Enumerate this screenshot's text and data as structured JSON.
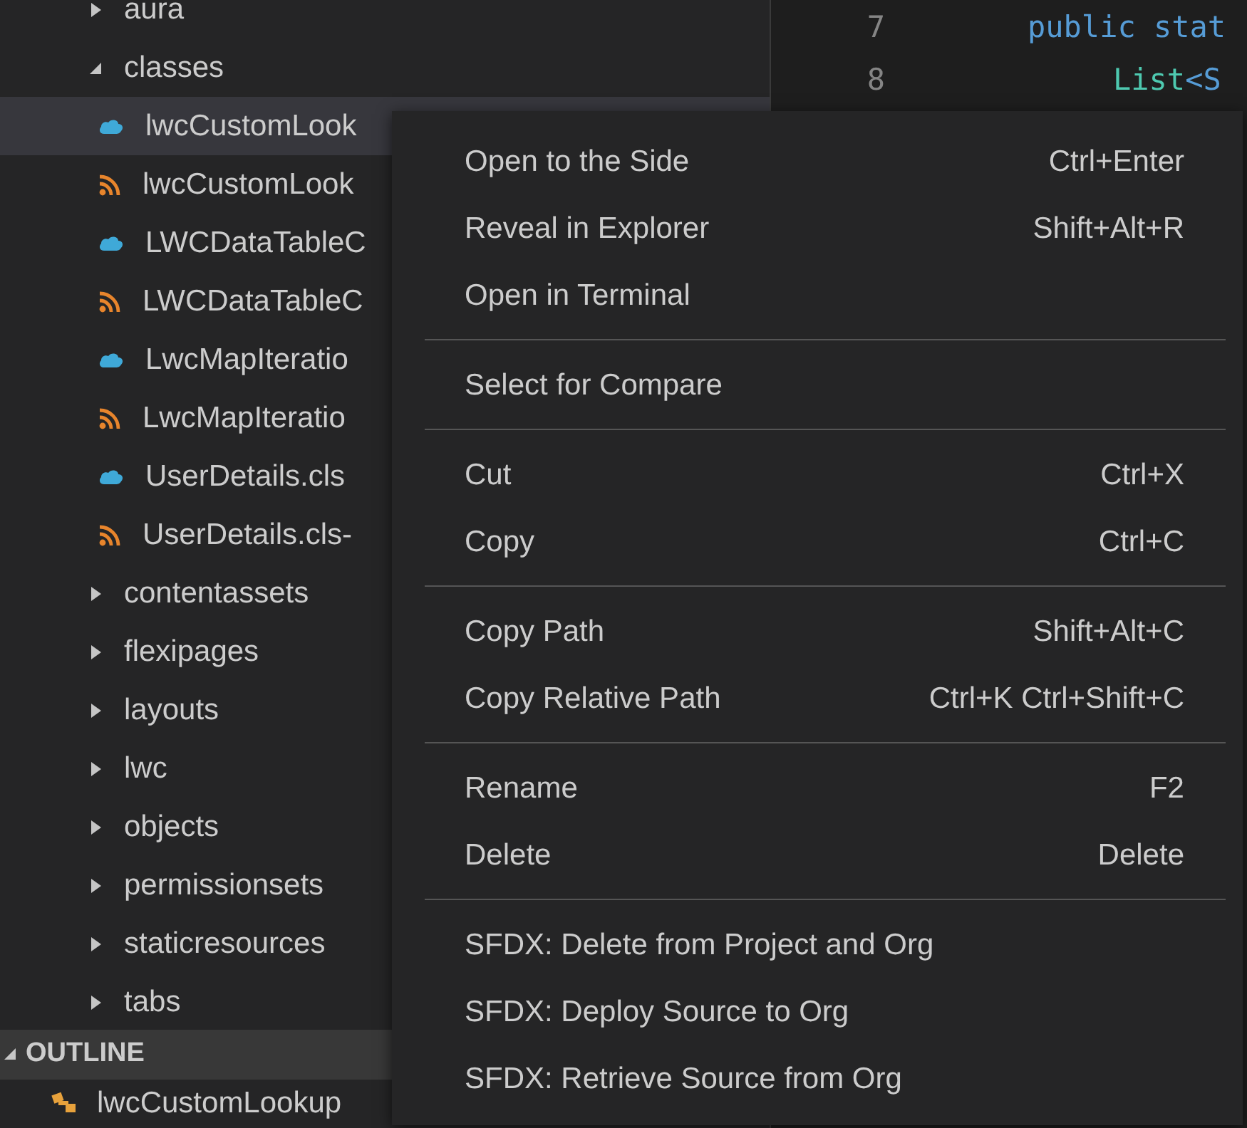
{
  "explorer": {
    "tree": [
      {
        "label": "aura",
        "expanded": false,
        "selected": false
      },
      {
        "label": "classes",
        "expanded": true,
        "selected": false,
        "children": [
          {
            "label": "lwcCustomLook",
            "kind": "apex",
            "selected": true
          },
          {
            "label": "lwcCustomLook",
            "kind": "meta",
            "selected": false
          },
          {
            "label": "LWCDataTableC",
            "kind": "apex",
            "selected": false
          },
          {
            "label": "LWCDataTableC",
            "kind": "meta",
            "selected": false
          },
          {
            "label": "LwcMapIteratio",
            "kind": "apex",
            "selected": false
          },
          {
            "label": "LwcMapIteratio",
            "kind": "meta",
            "selected": false
          },
          {
            "label": "UserDetails.cls",
            "kind": "apex",
            "selected": false
          },
          {
            "label": "UserDetails.cls-",
            "kind": "meta",
            "selected": false
          }
        ]
      },
      {
        "label": "contentassets",
        "expanded": false,
        "selected": false
      },
      {
        "label": "flexipages",
        "expanded": false,
        "selected": false
      },
      {
        "label": "layouts",
        "expanded": false,
        "selected": false
      },
      {
        "label": "lwc",
        "expanded": false,
        "selected": false
      },
      {
        "label": "objects",
        "expanded": false,
        "selected": false
      },
      {
        "label": "permissionsets",
        "expanded": false,
        "selected": false
      },
      {
        "label": "staticresources",
        "expanded": false,
        "selected": false
      },
      {
        "label": "tabs",
        "expanded": false,
        "selected": false
      }
    ]
  },
  "outline": {
    "title": "OUTLINE",
    "expanded": true,
    "items": [
      {
        "label": "lwcCustomLookup"
      }
    ]
  },
  "editor": {
    "lines": [
      {
        "number": "7",
        "kind": "declaration",
        "tokens": [
          {
            "text": "public stat",
            "kind": "keyword"
          }
        ]
      },
      {
        "number": "8",
        "kind": "body",
        "tokens": [
          {
            "text": "List",
            "kind": "type"
          },
          {
            "text": "<S",
            "kind": "keyword"
          }
        ]
      }
    ]
  },
  "context_menu": {
    "groups": [
      [
        {
          "label": "Open to the Side",
          "shortcut": "Ctrl+Enter"
        },
        {
          "label": "Reveal in Explorer",
          "shortcut": "Shift+Alt+R"
        },
        {
          "label": "Open in Terminal"
        }
      ],
      [
        {
          "label": "Select for Compare"
        }
      ],
      [
        {
          "label": "Cut",
          "shortcut": "Ctrl+X"
        },
        {
          "label": "Copy",
          "shortcut": "Ctrl+C"
        }
      ],
      [
        {
          "label": "Copy Path",
          "shortcut": "Shift+Alt+C"
        },
        {
          "label": "Copy Relative Path",
          "shortcut": "Ctrl+K Ctrl+Shift+C"
        }
      ],
      [
        {
          "label": "Rename",
          "shortcut": "F2"
        },
        {
          "label": "Delete",
          "shortcut": "Delete"
        }
      ],
      [
        {
          "label": "SFDX: Delete from Project and Org"
        },
        {
          "label": "SFDX: Deploy Source to Org"
        },
        {
          "label": "SFDX: Retrieve Source from Org"
        }
      ]
    ]
  }
}
